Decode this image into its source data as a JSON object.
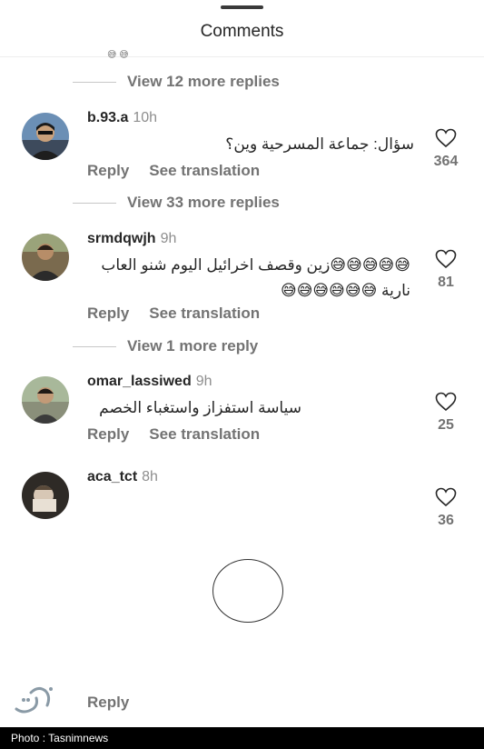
{
  "header": {
    "title": "Comments"
  },
  "threads": [
    {
      "view_more": "View 12 more replies"
    },
    {
      "view_more": "View 33 more replies"
    },
    {
      "view_more": "View 1 more reply"
    }
  ],
  "comments": [
    {
      "username": "b.93.a",
      "time": "10h",
      "text": "سؤال: جماعة المسرحية وين؟",
      "reply": "Reply",
      "translate": "See translation",
      "likes": "364"
    },
    {
      "username": "srmdqwjh",
      "time": "9h",
      "text": "😅😅😅😅😅زين وقصف اخرائيل اليوم شنو العاب نارية 😅😅😅😅😅😅",
      "reply": "Reply",
      "translate": "See translation",
      "likes": "81"
    },
    {
      "username": "omar_lassiwed",
      "time": "9h",
      "text": "سياسة استفزاز واستغباء الخصم",
      "reply": "Reply",
      "translate": "See translation",
      "likes": "25"
    },
    {
      "username": "aca_tct",
      "time": "8h",
      "likes": "36"
    }
  ],
  "bottom": {
    "reply": "Reply"
  },
  "footer": {
    "credit": "Photo : Tasnimnews"
  },
  "icons": {
    "like": "heart-outline-icon",
    "loading": "loading-circle-icon",
    "watermark": "tasnim-logo"
  }
}
